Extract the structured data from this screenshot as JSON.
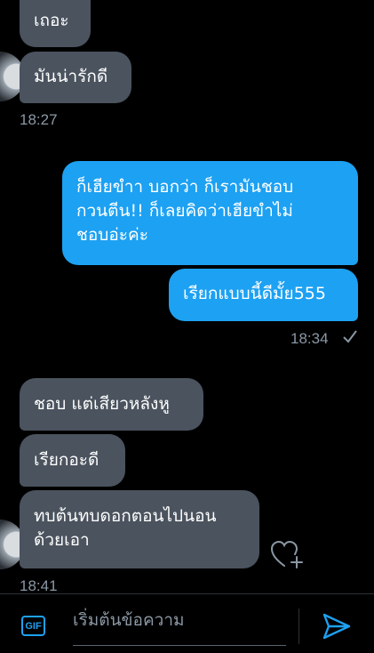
{
  "messages": {
    "in1": "เถอะ",
    "in2": "มันน่ารักดี",
    "time1": "18:27",
    "out1_line1": "ก็เฮียขำา บอกว่า ก็เรามันชอบ",
    "out1_line2": "กวนตีน!! ก็เลยคิดว่าเฮียขำไม่",
    "out1_line3": "ชอบอ่ะค่ะ",
    "out2": "เรียกแบบนี้ดีมั้ย555",
    "time2": "18:34",
    "in3": "ชอบ แต่เสียวหลังหู",
    "in4": "เรียกอะดี",
    "in5_line1": "ทบต้นทบดอกตอนไปนอน",
    "in5_line2": "ด้วยเอา",
    "time3": "18:41"
  },
  "composer": {
    "gif_label": "GIF",
    "placeholder": "เริ่มต้นข้อความ"
  },
  "colors": {
    "incoming_bubble": "#4a535e",
    "outgoing_bubble": "#1da1f2",
    "accent": "#1da1f2",
    "timestamp": "#8b98a5"
  },
  "icons": {
    "send": "send-icon",
    "heart": "heart-plus-icon",
    "read": "check-icon",
    "gif": "gif-icon"
  }
}
